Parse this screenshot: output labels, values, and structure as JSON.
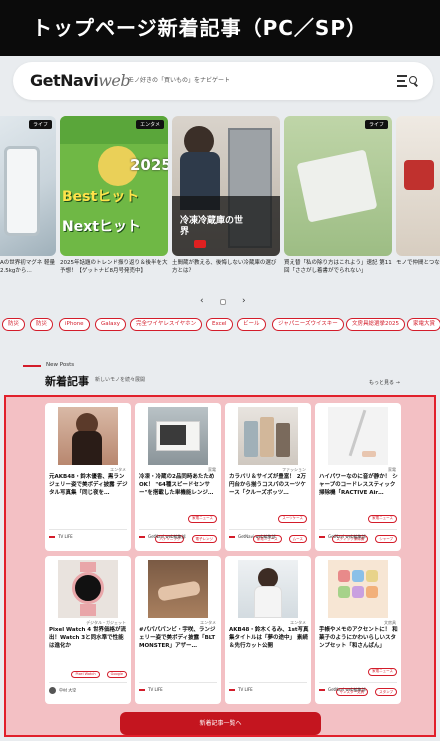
{
  "page_title": "トップページ新着記事（PC／SP）",
  "header": {
    "logo_main": "GetNavi",
    "logo_sub": "web",
    "tagline": "モノ好きの「買いもの」をナビゲート"
  },
  "carousel": {
    "cards": [
      {
        "caption": "Aの世界初マグネ 軽量2.5kgから…",
        "category": "ライフ"
      },
      {
        "caption": "2025年話題のトレンド振り返り＆後半を大予想！【ゲットナビ8月号発売中】",
        "category": "エンタメ",
        "cover_text_1": "2025",
        "cover_text_2": "Bestヒット",
        "cover_text_3": "Nextヒット"
      },
      {
        "caption": "土間蔵が教える、後悔しない冷蔵庫の選び方とは？",
        "category": "",
        "video_text": "冷凍冷蔵庫の世界"
      },
      {
        "caption": "買え替「私の除り方はこれよう」速記 第11回「ささがし着書がでられない」",
        "category": "ライフ"
      },
      {
        "caption": "モノで仲間とつなー一連携コミュ…",
        "category": ""
      }
    ],
    "pager_prev": "‹",
    "pager_next": "›"
  },
  "tags": [
    "防災",
    "防災",
    "iPhone",
    "Galaxy",
    "完全ワイヤレスイヤホン",
    "Excel",
    "ビール",
    "ジャパニーズウイスキー",
    "文房具総選挙2025",
    "家電大賞"
  ],
  "new_posts": {
    "label_en": "New Posts",
    "title": "新着記事",
    "subtitle": "新しいモノを続々展開",
    "more": "もっと見る →",
    "items": [
      {
        "category": "エンタメ",
        "title": "元AKB48・鈴木優香、黒ランジェリー姿で美ボディ披露 デジタル写真集「同じ夜を…",
        "tags": [],
        "source": "TV LIFE"
      },
      {
        "category": "家電",
        "title": "冷凍・冷蔵の2品同時あたためOK！ \"64種スピードセンサー\"を搭載した単機能レンジ…",
        "tags": [
          "家電ニュース",
          "パナソニック",
          "電子レンジ"
        ],
        "source": "GetNavi web編集部"
      },
      {
        "category": "ファッション",
        "title": "カラバリ＆サイズが豊富！ 2万円台から揃うコスパのスーツケース「クルーズボッツ…",
        "tags": [
          "スーツケース",
          "家電ニュース",
          "ムース"
        ],
        "source": "GetNavi web編集部"
      },
      {
        "category": "家電",
        "title": "ハイパワーなのに音が静か！ シャープのコードレススティック掃除機「RACTIVE Air…",
        "tags": [
          "家電ニュース",
          "スティック掃除機",
          "シャープ"
        ],
        "source": "GetNavi web編集部"
      },
      {
        "category": "デジタル・ガジェット",
        "title": "Pixel Watch 4 世界価格が流出！Watch 3と同水準で性能は進化か",
        "tags": [
          "Pixel Watch",
          "Google"
        ],
        "source": "中村 大空"
      },
      {
        "category": "エンタメ",
        "title": "#パパパパンビ・宇咲、ランジェリー姿で美ボディ披露「BLT MONSTER」アザー…",
        "tags": [],
        "source": "TV LIFE"
      },
      {
        "category": "エンタメ",
        "title": "AKB48・鈴木くるみ、1st写真集タイトルは「夢の途中」 素続＆先行カット公開",
        "tags": [],
        "source": "TV LIFE"
      },
      {
        "category": "文房具",
        "title": "手帳やメモのアクセントに！ 和菓子のようにかわいらしいスタンプセット「和さんぱん」",
        "tags": [
          "家電ニュース",
          "サンスター文具",
          "スタンプ"
        ],
        "source": "GetNavi web編集部"
      }
    ],
    "button_label": "新着記事一覧へ"
  },
  "colors": {
    "accent": "#d31c2a",
    "highlight_border": "#e1202b",
    "highlight_bg": "#f3c0c4"
  }
}
